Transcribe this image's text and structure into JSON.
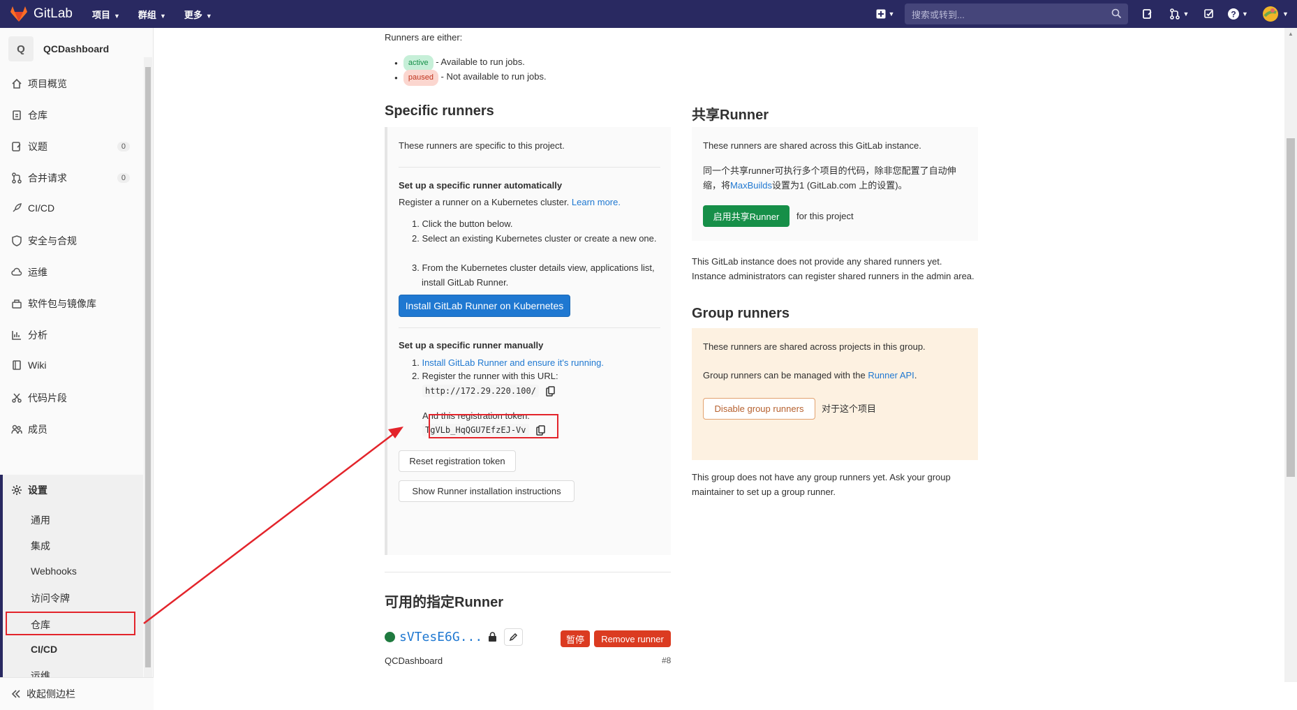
{
  "topbar": {
    "brand": "GitLab",
    "menu": [
      "项目",
      "群组",
      "更多"
    ],
    "search_placeholder": "搜索或转到..."
  },
  "sidebar": {
    "project_initial": "Q",
    "project_name": "QCDashboard",
    "items": [
      {
        "label": "项目概览",
        "icon": "home-icon"
      },
      {
        "label": "仓库",
        "icon": "doc-icon"
      },
      {
        "label": "议题",
        "icon": "issues-icon",
        "count": "0"
      },
      {
        "label": "合并请求",
        "icon": "merge-icon",
        "count": "0"
      },
      {
        "label": "CI/CD",
        "icon": "rocket-icon"
      },
      {
        "label": "安全与合规",
        "icon": "shield-icon"
      },
      {
        "label": "运维",
        "icon": "cloud-icon"
      },
      {
        "label": "软件包与镜像库",
        "icon": "package-icon"
      },
      {
        "label": "分析",
        "icon": "chart-icon"
      },
      {
        "label": "Wiki",
        "icon": "book-icon"
      },
      {
        "label": "代码片段",
        "icon": "scissors-icon"
      },
      {
        "label": "成员",
        "icon": "users-icon"
      },
      {
        "label": "设置",
        "icon": "gear-icon"
      }
    ],
    "sub_items": [
      "通用",
      "集成",
      "Webhooks",
      "访问令牌",
      "仓库",
      "CI/CD",
      "运维"
    ],
    "collapse": "收起侧边栏"
  },
  "intro": {
    "text": "Runners are either:",
    "active_badge": "active",
    "active_text": " - Available to run jobs.",
    "paused_badge": "paused",
    "paused_text": " - Not available to run jobs."
  },
  "specific": {
    "title": "Specific runners",
    "desc": "These runners are specific to this project.",
    "auto_title": "Set up a specific runner automatically",
    "auto_desc": "Register a runner on a Kubernetes cluster.",
    "learn_more": "Learn more.",
    "steps": [
      "Click the button below.",
      "Select an existing Kubernetes cluster or create a new one.",
      "From the Kubernetes cluster details view, applications list, install GitLab Runner."
    ],
    "install_button": "Install GitLab Runner on Kubernetes",
    "manual_title": "Set up a specific runner manually",
    "manual_step1": "Install GitLab Runner and ensure it's running.",
    "manual_step2": "Register the runner with this URL:",
    "url": "http://172.29.220.100/",
    "token_label": "And this registration token:",
    "token": "TgVLb_HqQGU7EfzEJ-Vv",
    "reset_button": "Reset registration token",
    "show_button": "Show Runner installation instructions"
  },
  "shared": {
    "title": "共享Runner",
    "desc": "These runners are shared across this GitLab instance.",
    "desc2_a": "同一个共享runner可执行多个项目的代码，除非您配置了自动伸缩，将",
    "desc2_link": "MaxBuilds",
    "desc2_b": "设置为1 (GitLab.com 上的设置)。",
    "enable_button": "启用共享Runner",
    "for_project": "for this project",
    "none": "This GitLab instance does not provide any shared runners yet. Instance administrators can register shared runners in the admin area."
  },
  "group": {
    "title": "Group runners",
    "desc": "These runners are shared across projects in this group.",
    "managed_a": "Group runners can be managed with the ",
    "managed_link": "Runner API",
    "managed_b": ".",
    "disable_button": "Disable group runners",
    "for_project": "对于这个项目",
    "none": "This group does not have any group runners yet. Ask your group maintainer to set up a group runner."
  },
  "available": {
    "title": "可用的指定Runner",
    "runner_name": "sVTesE6G...",
    "pause_button": "暂停",
    "remove_button": "Remove runner",
    "project": "QCDashboard",
    "project_id": "#8"
  },
  "colors": {
    "topbar": "#292961",
    "link": "#1f78d1",
    "primary": "#1f78d1",
    "success": "#1aaa55",
    "danger": "#db3b21",
    "annotation": "#e3242b"
  }
}
